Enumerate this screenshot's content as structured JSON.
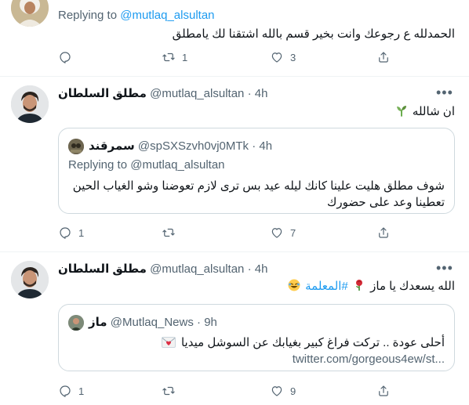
{
  "tweets": [
    {
      "replying_prefix": "Replying to",
      "replying_handle": "@mutlaq_alsultan",
      "text": "الحمدلله  ع رجوعك وانت بخير قسم بالله اشتقنا لك يامطلق",
      "actions": {
        "reply": "",
        "retweet": "1",
        "like": "3",
        "share": ""
      }
    },
    {
      "name": "مطلق السلطان",
      "handle": "@mutlaq_alsultan",
      "sep": "·",
      "time": "4h",
      "text": "ان شالله",
      "emoji": "seedling-icon",
      "quote": {
        "name": "سمرقند",
        "handle": "@spSXSzvh0vj0MTk",
        "sep": "·",
        "time": "4h",
        "replying_prefix": "Replying to",
        "replying_handle": "@mutlaq_alsultan",
        "text": "شوف مطلق هليت علينا كانك ليله عيد بس ترى لازم تعوضنا وشو الغياب الحين تعطينا وعد على حضورك"
      },
      "actions": {
        "reply": "1",
        "retweet": "",
        "like": "7",
        "share": ""
      }
    },
    {
      "name": "مطلق السلطان",
      "handle": "@mutlaq_alsultan",
      "sep": "·",
      "time": "4h",
      "text": "الله يسعدك يا ماز",
      "hashtag": "#المعلمة",
      "emojis": [
        "rose-icon",
        "laughing-face-icon"
      ],
      "quote": {
        "name": "ماز",
        "handle": "@Mutlaq_News",
        "sep": "·",
        "time": "9h",
        "text": "أحلى عودة .. تركت فراغ كبير بغيابك عن السوشل ميديا",
        "link": "twitter.com/gorgeous4ew/st..."
      },
      "actions": {
        "reply": "1",
        "retweet": "",
        "like": "9",
        "share": ""
      }
    }
  ],
  "colors": {
    "accent": "#1d9bf0",
    "muted": "#536471",
    "border": "#cfd9de",
    "divider": "#eff3f4"
  }
}
